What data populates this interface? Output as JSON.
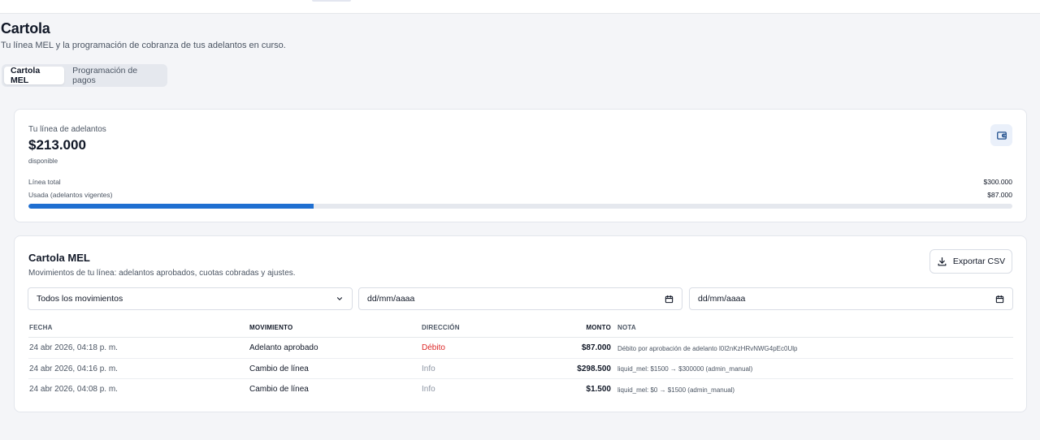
{
  "page": {
    "title": "Cartola",
    "subtitle": "Tu línea MEL y la programación de cobranza de tus adelantos en curso."
  },
  "tabs": [
    {
      "label": "Cartola MEL",
      "active": true
    },
    {
      "label": "Programación de pagos",
      "active": false
    }
  ],
  "credit_line": {
    "label": "Tu línea de adelantos",
    "available_amount": "$213.000",
    "available_label": "disponible",
    "icon": "wallet-icon",
    "total_label": "Línea total",
    "total_value": "$300.000",
    "used_label": "Usada (adelantos vigentes)",
    "used_value": "$87.000",
    "usage_fraction": 0.29
  },
  "cartola": {
    "title": "Cartola MEL",
    "subtitle": "Movimientos de tu línea: adelantos aprobados, cuotas cobradas y ajustes.",
    "export_label": "Exportar CSV",
    "filters": {
      "movement_type": "Todos los movimientos",
      "date_from_placeholder": "dd/mm/aaaa",
      "date_to_placeholder": "dd/mm/aaaa"
    },
    "columns": {
      "fecha": "FECHA",
      "movimiento": "MOVIMIENTO",
      "direccion": "DIRECCIÓN",
      "monto": "MONTO",
      "nota": "NOTA"
    },
    "rows": [
      {
        "fecha": "24 abr 2026, 04:18 p. m.",
        "movimiento": "Adelanto aprobado",
        "direccion": "Débito",
        "monto": "$87.000",
        "nota": "Débito por aprobación de adelanto l0I2nKzHRvNWG4pEc0Ulp"
      },
      {
        "fecha": "24 abr 2026, 04:16 p. m.",
        "movimiento": "Cambio de línea",
        "direccion": "Info",
        "monto": "$298.500",
        "nota": "liquid_mel: $1500 → $300000 (admin_manual)"
      },
      {
        "fecha": "24 abr 2026, 04:08 p. m.",
        "movimiento": "Cambio de línea",
        "direccion": "Info",
        "monto": "$1.500",
        "nota": "liquid_mel: $0 → $1500 (admin_manual)"
      }
    ]
  },
  "colors": {
    "accent": "#1f6fd1",
    "debit": "#dc2626",
    "info": "#8d95a3"
  }
}
